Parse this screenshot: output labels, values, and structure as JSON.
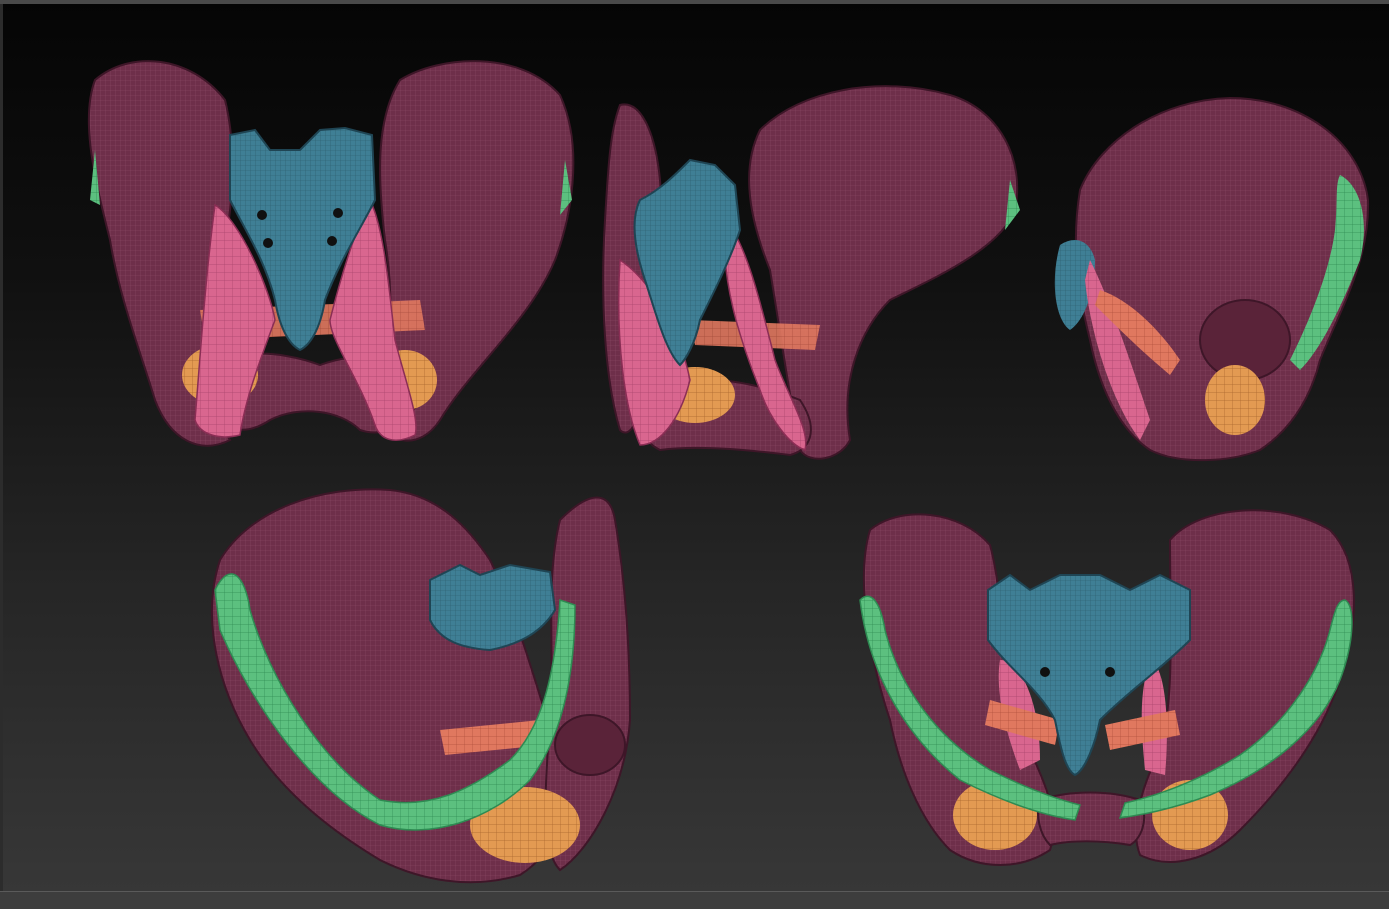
{
  "viewport": {
    "type": "3d-render",
    "subject": "pelvis-model",
    "views": [
      {
        "id": "front-top"
      },
      {
        "id": "oblique-front"
      },
      {
        "id": "side"
      },
      {
        "id": "oblique-inner"
      },
      {
        "id": "front-tilted"
      }
    ]
  },
  "colors": {
    "bone": "#6e2f4a",
    "bone_light": "#8a4461",
    "bone_dark": "#3e1628",
    "sacrum": "#3f7f95",
    "sacrum_dark": "#25566a",
    "muscle_pink": "#d9668f",
    "muscle_pink_dark": "#a8436b",
    "muscle_orange": "#e0865f",
    "ligament_green": "#5cc07f",
    "cartilage_orange": "#e39a52",
    "background_top": "#050505",
    "background_bottom": "#383838"
  }
}
